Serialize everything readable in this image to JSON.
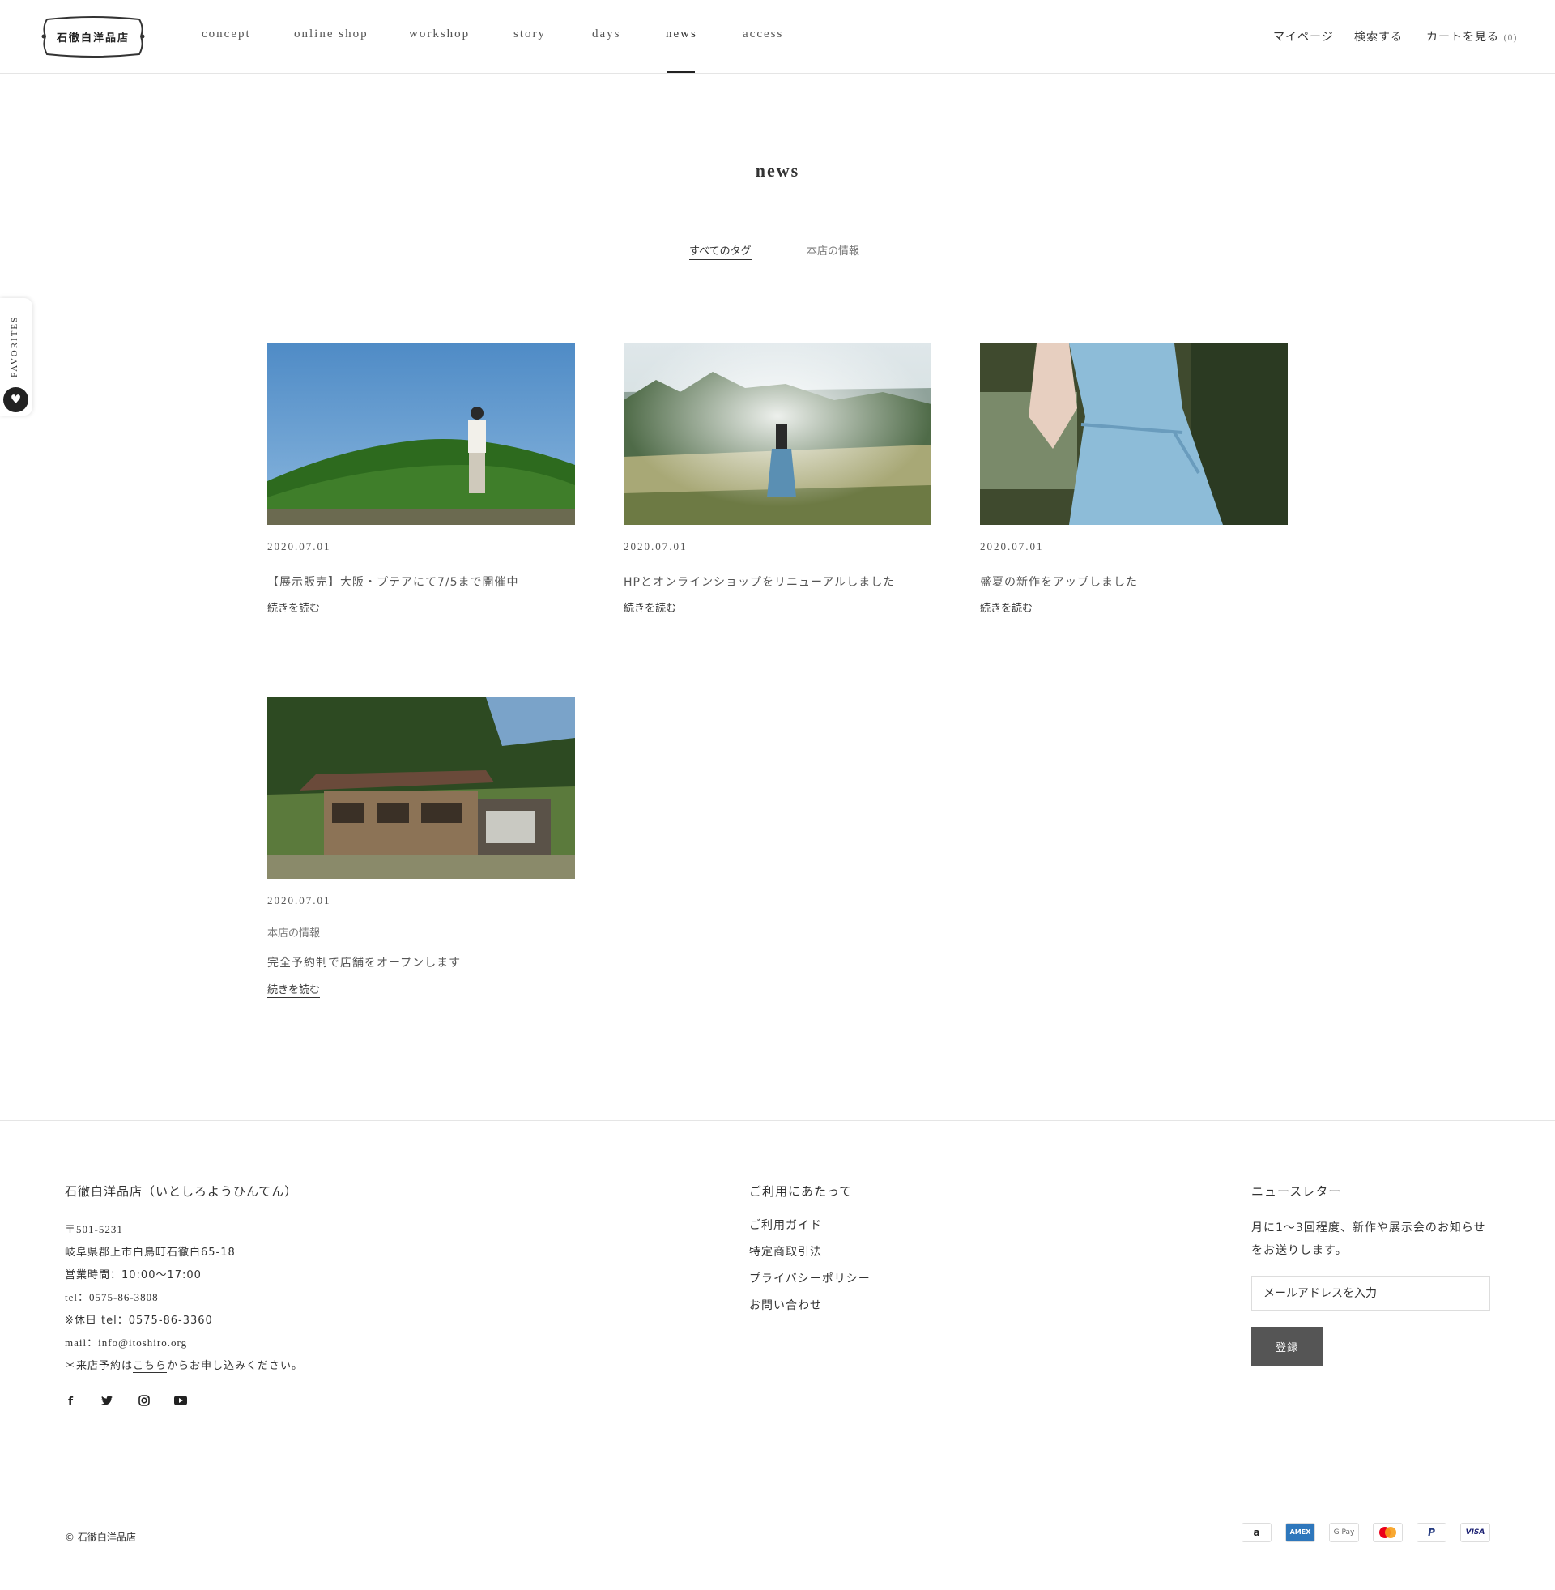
{
  "header": {
    "logo_text": "石徹白洋品店",
    "nav": [
      "concept",
      "online shop",
      "workshop",
      "story",
      "days",
      "news",
      "access"
    ],
    "active_nav": "news",
    "mypage": "マイページ",
    "search": "検索する",
    "cart": "カートを見る",
    "cart_count": "(0)"
  },
  "favorites": {
    "label": "FAVORITES"
  },
  "page": {
    "title": "news",
    "tags": [
      "すべてのタグ",
      "本店の情報"
    ]
  },
  "articles": [
    {
      "date": "2020.07.01",
      "title": "【展示販売】大阪・プテアにて7/5まで開催中",
      "read_more": "続きを読む",
      "image": "person-on-hill"
    },
    {
      "date": "2020.07.01",
      "title": "HPとオンラインショップをリニューアルしました",
      "read_more": "続きを読む",
      "image": "woman-in-field"
    },
    {
      "date": "2020.07.01",
      "title": "盛夏の新作をアップしました",
      "read_more": "続きを読む",
      "image": "blue-dress"
    },
    {
      "date": "2020.07.01",
      "tag": "本店の情報",
      "title": "完全予約制で店舗をオープンします",
      "read_more": "続きを読む",
      "image": "wooden-house"
    }
  ],
  "footer": {
    "about_heading": "石徹白洋品店（いとしろようひんてん）",
    "postal": "〒501-5231",
    "address": "岐阜県郡上市白鳥町石徹白65-18",
    "hours": "営業時間：10:00〜17:00",
    "tel": "tel：0575-86-3808",
    "holiday_tel": "※休日 tel：0575-86-3360",
    "mail": "mail：info@itoshiro.org",
    "reservation_prefix": "＊来店予約は",
    "reservation_link": "こちら",
    "reservation_suffix": "からお申し込みください。",
    "social": [
      "facebook-icon",
      "twitter-icon",
      "instagram-icon",
      "youtube-icon"
    ],
    "links_heading": "ご利用にあたって",
    "links": [
      "ご利用ガイド",
      "特定商取引法",
      "プライバシーポリシー",
      "お問い合わせ"
    ],
    "newsletter_heading": "ニュースレター",
    "newsletter_text_1": "月に1〜3回程度、新作や展示会のお知らせ",
    "newsletter_text_2": "をお送りします。",
    "email_placeholder": "メールアドレスを入力",
    "subscribe": "登録",
    "copyright": "© 石徹白洋品店",
    "payments": [
      {
        "name": "amazon",
        "label": "a"
      },
      {
        "name": "amex",
        "label": "AMEX"
      },
      {
        "name": "google-pay",
        "label": "G Pay"
      },
      {
        "name": "mastercard",
        "label": ""
      },
      {
        "name": "paypal",
        "label": "P"
      },
      {
        "name": "visa",
        "label": "VISA"
      }
    ]
  }
}
